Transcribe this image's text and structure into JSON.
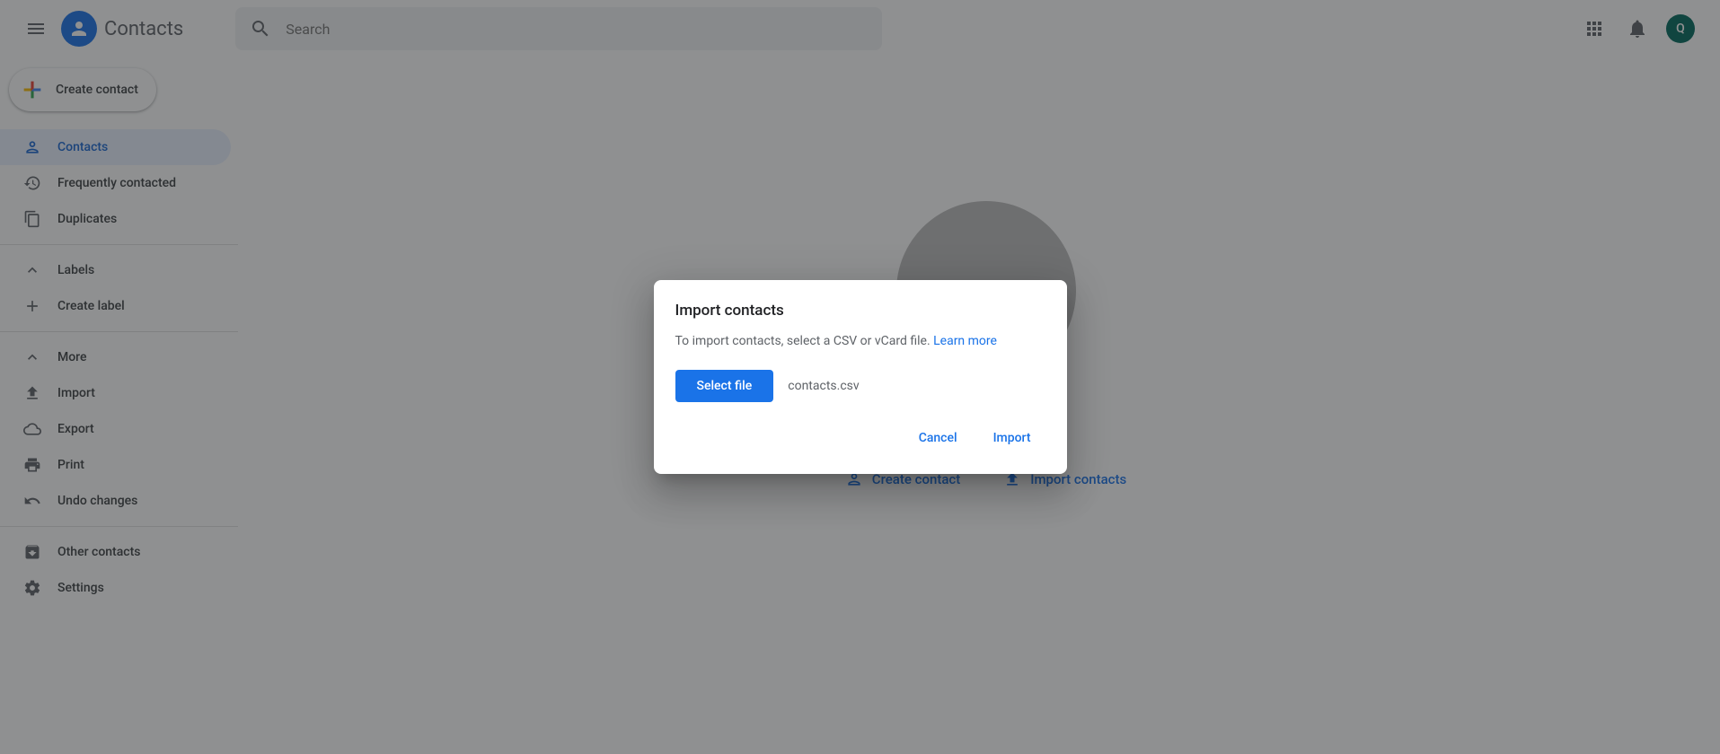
{
  "header": {
    "app_name": "Contacts",
    "search_placeholder": "Search",
    "avatar_letter": "Q"
  },
  "sidebar": {
    "create_label": "Create contact",
    "items": [
      {
        "label": "Contacts"
      },
      {
        "label": "Frequently contacted"
      },
      {
        "label": "Duplicates"
      }
    ],
    "labels_section": {
      "header": "Labels",
      "create": "Create label"
    },
    "more_section": {
      "header": "More",
      "items": [
        {
          "label": "Import"
        },
        {
          "label": "Export"
        },
        {
          "label": "Print"
        },
        {
          "label": "Undo changes"
        }
      ]
    },
    "other_contacts": "Other contacts",
    "settings": "Settings"
  },
  "main": {
    "create_contact": "Create contact",
    "import_contacts": "Import contacts"
  },
  "dialog": {
    "title": "Import contacts",
    "body_text": "To import contacts, select a CSV or vCard file. ",
    "learn_more": "Learn more",
    "select_file": "Select file",
    "file_name": "contacts.csv",
    "cancel": "Cancel",
    "import": "Import"
  }
}
